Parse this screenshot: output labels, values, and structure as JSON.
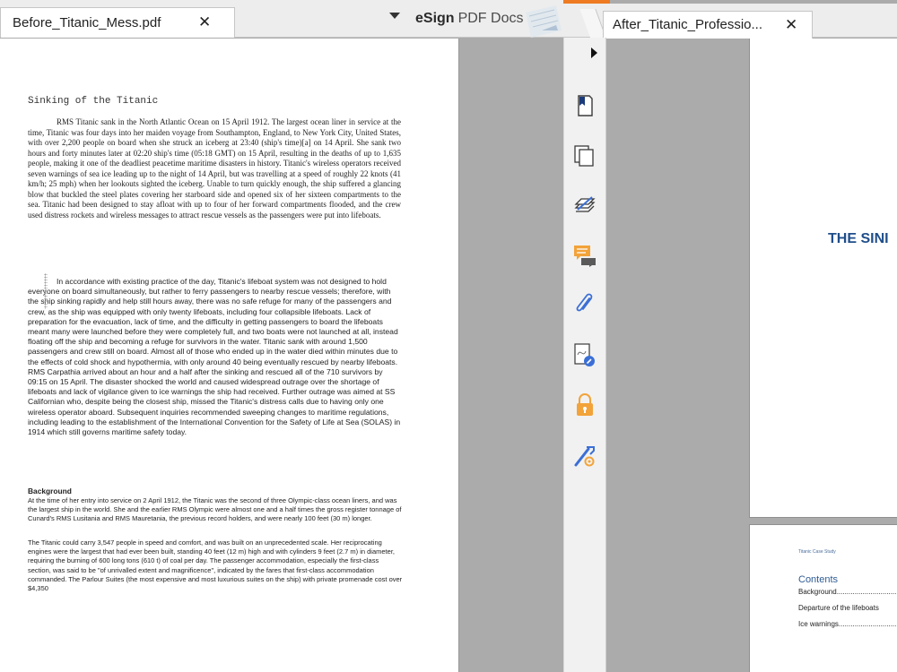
{
  "left_tab": {
    "label": "Before_Titanic_Mess.pdf",
    "close": "✕"
  },
  "brand": {
    "bold": "eSign",
    "light": "PDF Docs"
  },
  "right_tab": {
    "label": "After_Titanic_Professio...",
    "close": "✕"
  },
  "left_doc": {
    "title": "Sinking of the Titanic",
    "para1": "RMS Titanic sank in the North Atlantic Ocean on 15 April 1912. The largest ocean liner in service at the time, Titanic was four days into her maiden voyage from Southampton, England, to New York City, United States, with over 2,200 people on board when she struck an iceberg at 23:40 (ship's time)[a] on 14 April. She sank two hours and forty minutes later at 02:20 ship's time (05:18 GMT) on 15 April, resulting in the deaths of up to 1,635 people, making it one of the deadliest peacetime maritime disasters in history. Titanic's wireless operators received seven warnings of sea ice leading up to the night of 14 April, but was travelling at a speed of roughly 22 knots (41 km/h; 25 mph) when her lookouts sighted the iceberg. Unable to turn quickly enough, the ship suffered a glancing blow that buckled the steel plates covering her starboard side and opened six of her sixteen compartments to the sea. Titanic had been designed to stay afloat with up to four of her forward compartments flooded, and the crew used distress rockets and wireless messages to attract rescue vessels as the passengers were put into lifeboats.",
    "para2": "In accordance with existing practice of the day, Titanic's lifeboat system was not designed to hold everyone on board simultaneously, but rather to ferry passengers to nearby rescue vessels; therefore, with the ship sinking rapidly and help still hours away, there was no safe refuge for many of the passengers and crew, as the ship was equipped with only twenty lifeboats, including four collapsible lifeboats. Lack of preparation for the evacuation, lack of time, and the difficulty in getting passengers to board the lifeboats meant many were launched before they were completely full, and two boats were not launched at all, instead floating off the ship and becoming a refuge for survivors in the water. Titanic sank with around 1,500 passengers and crew still on board. Almost all of those who ended up in the water died within minutes due to the effects of cold shock and hypothermia, with only around 40 being eventually rescued by nearby lifeboats. RMS Carpathia arrived about an hour and a half after the sinking and rescued all of the 710 survivors by 09:15 on 15 April. The disaster shocked the world and caused widespread outrage over the shortage of lifeboats and lack of vigilance given to ice warnings the ship had received. Further outrage was aimed at SS Californian who, despite being the closest ship, missed the Titanic's distress calls due to having only one wireless operator aboard. Subsequent inquiries recommended sweeping changes to maritime regulations, including leading to the establishment of the International Convention for the Safety of Life at Sea (SOLAS) in 1914 which still governs maritime safety today.",
    "bg_heading": "Background",
    "para3": "At the time of her entry into service on 2 April 1912, the Titanic was the second of three Olympic-class ocean liners, and was the largest ship in the world. She and the earlier RMS Olympic were almost one and a half times the gross register tonnage of Cunard's RMS Lusitania and RMS Mauretania, the previous record holders, and were nearly 100 feet (30 m) longer.",
    "para4": "The Titanic could carry 3,547 people in speed and comfort, and was built on an unprecedented scale. Her reciprocating engines were the largest that had ever been built, standing 40 feet (12 m) high and with cylinders 9 feet (2.7 m) in diameter, requiring the burning of 600 long tons (610 t) of coal per day. The passenger accommodation, especially the first-class section, was said to be \"of unrivalled extent and magnificence\", indicated by the fares that first-class accommodation commanded. The Parlour Suites (the most expensive and most luxurious suites on the ship) with private promenade cost over $4,350"
  },
  "right_doc": {
    "cover_title": "THE SINI",
    "toc_header": "Titanic Case Study",
    "toc_title": "Contents",
    "toc_items": [
      "Background.........................................",
      "Departure of the lifeboats",
      "Ice warnings........................................."
    ]
  },
  "sidebar_icons": [
    "bookmark-icon",
    "pages-icon",
    "layers-icon",
    "comments-icon",
    "attachment-icon",
    "signature-icon",
    "lock-icon",
    "tools-icon"
  ],
  "colors": {
    "accent_orange": "#ee7b22",
    "cover_title_blue": "#1f4e8a",
    "icon_blue": "#3b6fd6",
    "icon_orange": "#f2a33a"
  }
}
